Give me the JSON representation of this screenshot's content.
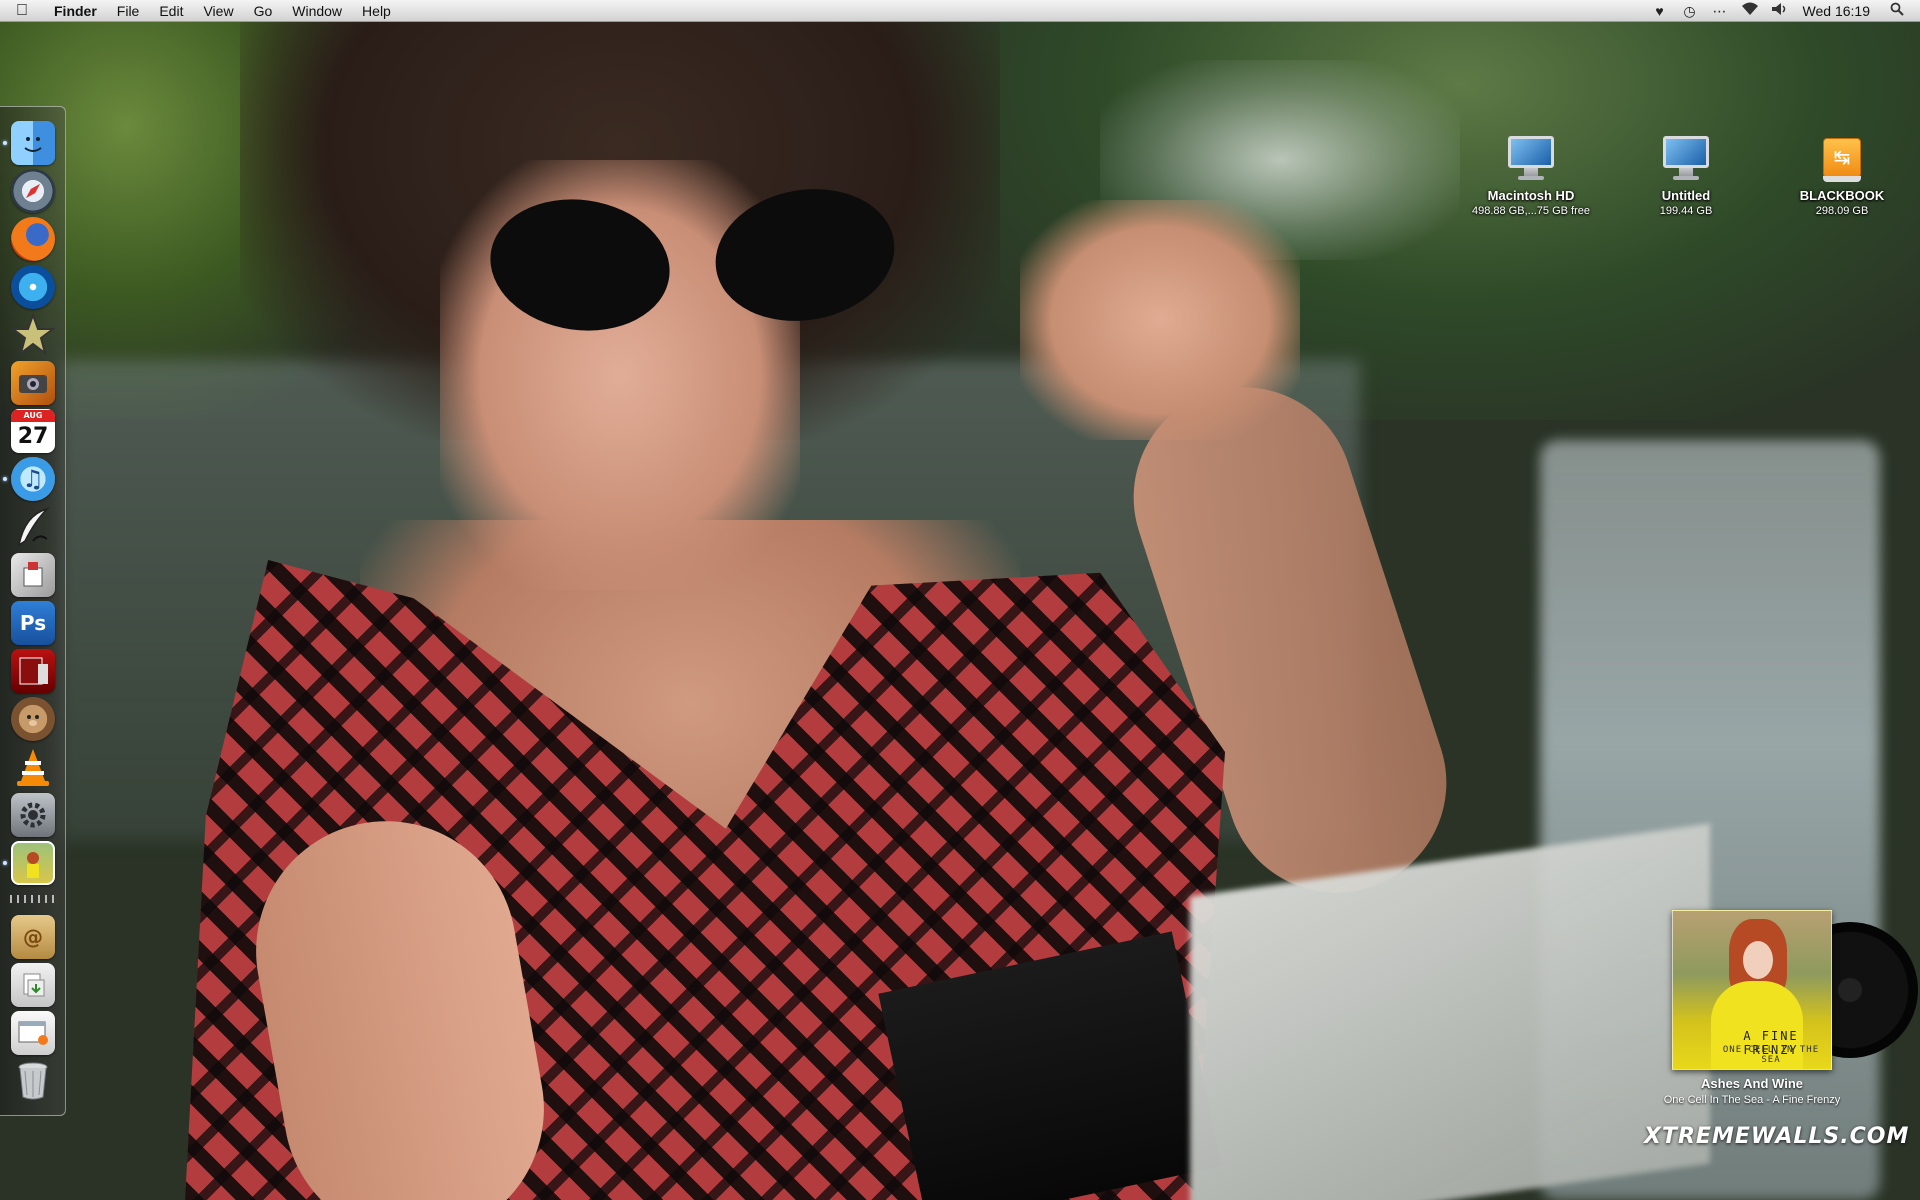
{
  "menubar": {
    "app_name": "Finder",
    "menus": [
      "File",
      "Edit",
      "View",
      "Go",
      "Window",
      "Help"
    ],
    "status_icons": [
      "heart-icon",
      "time-machine-icon",
      "menu-extra-icon",
      "wifi-icon",
      "volume-icon"
    ],
    "clock": "Wed 16:19"
  },
  "dock": {
    "items": [
      {
        "name": "finder",
        "running": true
      },
      {
        "name": "safari",
        "running": false
      },
      {
        "name": "firefox",
        "running": false
      },
      {
        "name": "dvd-player",
        "running": false
      },
      {
        "name": "imovie",
        "running": false
      },
      {
        "name": "iphoto",
        "running": false
      },
      {
        "name": "ical",
        "running": false,
        "date_day": "27",
        "date_month": "AUG"
      },
      {
        "name": "itunes",
        "running": true
      },
      {
        "name": "script-editor",
        "running": false
      },
      {
        "name": "preview-app",
        "running": false
      },
      {
        "name": "photoshop",
        "running": false,
        "label": "Ps"
      },
      {
        "name": "photo-booth",
        "running": false
      },
      {
        "name": "growl",
        "running": false
      },
      {
        "name": "vlc",
        "running": false
      },
      {
        "name": "system-preferences",
        "running": false
      },
      {
        "name": "wallpaper-app",
        "running": true
      },
      {
        "name": "mail-stack",
        "running": false
      },
      {
        "name": "downloads-stack",
        "running": false
      },
      {
        "name": "documents-stack",
        "running": false
      },
      {
        "name": "trash",
        "running": false
      }
    ]
  },
  "desktop": {
    "drives": [
      {
        "name": "Macintosh HD",
        "info": "498.88 GB,...75 GB free",
        "icon": "imac-icon"
      },
      {
        "name": "Untitled",
        "info": "199.44 GB",
        "icon": "imac-icon"
      },
      {
        "name": "BLACKBOOK",
        "info": "298.09 GB",
        "icon": "usb-drive-icon"
      }
    ]
  },
  "now_playing": {
    "album_title": "A FINE FRENZY",
    "album_subtitle": "ONE CELL IN THE SEA",
    "song": "Ashes And Wine",
    "artist_album": "One Cell In The Sea - A Fine Frenzy"
  },
  "watermark": "XTREMEWALLS.COM"
}
